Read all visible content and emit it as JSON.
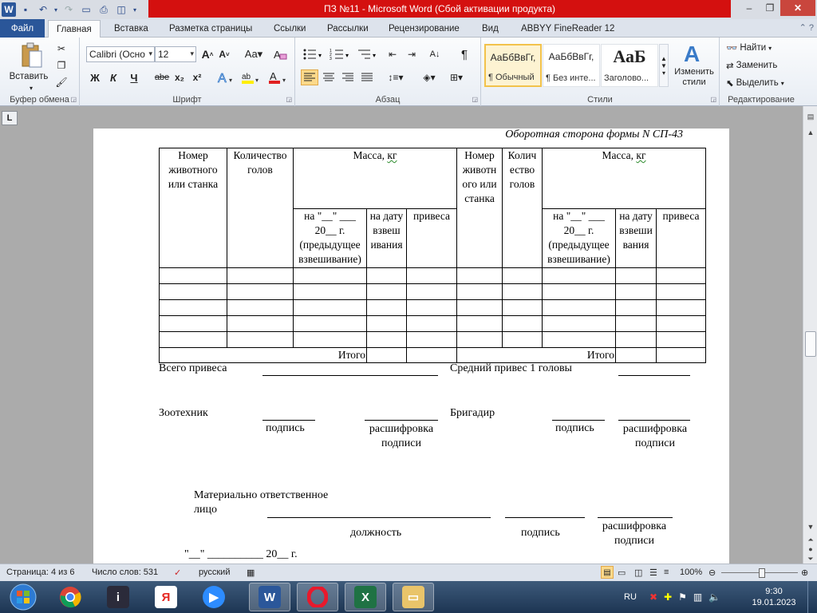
{
  "window": {
    "title": "ПЗ №11  -  Microsoft Word (Сбой активации продукта)",
    "minimize": "–",
    "restore": "❐",
    "close": "✕"
  },
  "qat": {
    "logo": "W",
    "save": "💾",
    "undo": "↶",
    "redo": "↷",
    "print": "🖶",
    "preview": "🗋"
  },
  "tabs": {
    "file": "Файл",
    "items": [
      "Главная",
      "Вставка",
      "Разметка страницы",
      "Ссылки",
      "Рассылки",
      "Рецензирование",
      "Вид",
      "ABBYY FineReader 12"
    ],
    "right_icons": "⌃ ?"
  },
  "ribbon": {
    "clipboard": {
      "paste": "Вставить",
      "label": "Буфер обмена"
    },
    "font": {
      "name": "Calibri (Осно",
      "size": "12",
      "bold": "Ж",
      "italic": "К",
      "underline": "Ч",
      "strike": "abe",
      "sub": "x₂",
      "sup": "x²",
      "grow": "A˄",
      "shrink": "A˅",
      "case": "Aa",
      "label": "Шрифт"
    },
    "paragraph": {
      "label": "Абзац",
      "pilcrow": "¶"
    },
    "styles": {
      "label": "Стили",
      "items": [
        {
          "sample": "АаБбВвГг,",
          "name": "¶ Обычный"
        },
        {
          "sample": "АаБбВвГг,",
          "name": "¶ Без инте..."
        },
        {
          "sample": "АаБ",
          "name": "Заголово..."
        }
      ],
      "change": "Изменить стили"
    },
    "editing": {
      "label": "Редактирование",
      "find": "Найти",
      "replace": "Заменить",
      "select": "Выделить"
    }
  },
  "ruler": {
    "tab_selector": "L"
  },
  "document": {
    "caption": "Оборотная сторона формы N СП-43",
    "table": {
      "h_num_left": "Номер животного или станка",
      "h_count_left": "Количество голов",
      "h_mass_left": "Масса, кг",
      "h_num_right": "Номер животн ого или станка",
      "h_count_right": "Колич ество голов",
      "h_mass_right": "Масса, кг",
      "sub_prev": "на \"__\" ___ 20__ г. (предыдущее взвешивание)",
      "sub_date": "на дату взвеш ивания",
      "sub_gain": "привеса",
      "sub_date_right": "на дату взвеши вания",
      "total": "Итого"
    },
    "total_gain": "Всего привеса",
    "avg_gain": "Средний привес 1 головы",
    "zootech": "Зоотехник",
    "brigadir": "Бригадир",
    "podpis": "подпись",
    "rasshifrovka": "расшифровка подписи",
    "mol_line1": "Материально ответственное",
    "mol_line2": "лицо",
    "dolzhnost": "должность",
    "date_line": "\"__\" __________ 20__ г."
  },
  "statusbar": {
    "page": "Страница: 4 из 6",
    "words": "Число слов: 531",
    "lang": "русский",
    "zoom": "100%"
  },
  "taskbar": {
    "lang": "RU",
    "time": "9:30",
    "date": "19.01.2023",
    "apps": [
      "chrome",
      "app-i",
      "yandex",
      "zoom",
      "word",
      "opera",
      "excel",
      "explorer"
    ]
  }
}
